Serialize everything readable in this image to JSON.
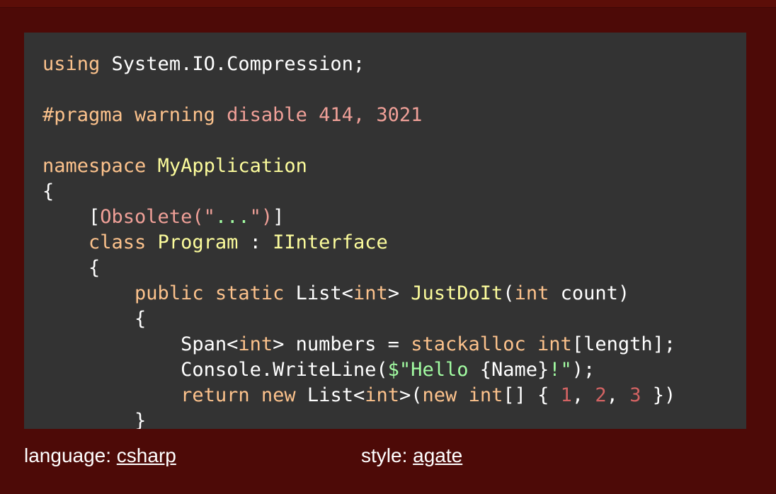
{
  "colors": {
    "background": "#4d0a07",
    "code_background": "#333333",
    "keyword": "#fcc28c",
    "title": "#fcfc9c",
    "meta": "#f0a098",
    "string": "#a2fca2",
    "number": "#d36363",
    "plain": "#ffffff"
  },
  "code_lines": [
    [
      [
        "k",
        "using"
      ],
      [
        "p",
        " System.IO.Compression;"
      ]
    ],
    [],
    [
      [
        "k",
        "#pragma warning"
      ],
      [
        "m",
        " disable 414, 3021"
      ]
    ],
    [],
    [
      [
        "k",
        "namespace"
      ],
      [
        "p",
        " "
      ],
      [
        "t",
        "MyApplication"
      ]
    ],
    [
      [
        "p",
        "{"
      ]
    ],
    [
      [
        "p",
        "    ["
      ],
      [
        "m",
        "Obsolete(\""
      ],
      [
        "s",
        "..."
      ],
      [
        "m",
        "\")"
      ],
      [
        "p",
        "]"
      ]
    ],
    [
      [
        "p",
        "    "
      ],
      [
        "k",
        "class"
      ],
      [
        "p",
        " "
      ],
      [
        "t",
        "Program"
      ],
      [
        "p",
        " : "
      ],
      [
        "t",
        "IInterface"
      ]
    ],
    [
      [
        "p",
        "    {"
      ]
    ],
    [
      [
        "p",
        "        "
      ],
      [
        "k",
        "public"
      ],
      [
        "p",
        " "
      ],
      [
        "k",
        "static"
      ],
      [
        "p",
        " List<"
      ],
      [
        "k",
        "int"
      ],
      [
        "p",
        "> "
      ],
      [
        "t",
        "JustDoIt"
      ],
      [
        "p",
        "("
      ],
      [
        "k",
        "int"
      ],
      [
        "p",
        " count)"
      ]
    ],
    [
      [
        "p",
        "        {"
      ]
    ],
    [
      [
        "p",
        "            Span<"
      ],
      [
        "k",
        "int"
      ],
      [
        "p",
        "> numbers = "
      ],
      [
        "k",
        "stackalloc"
      ],
      [
        "p",
        " "
      ],
      [
        "k",
        "int"
      ],
      [
        "p",
        "[length];"
      ]
    ],
    [
      [
        "p",
        "            Console.WriteLine("
      ],
      [
        "s",
        "$\"Hello "
      ],
      [
        "p",
        "{Name}"
      ],
      [
        "s",
        "!\""
      ],
      [
        "p",
        ");"
      ]
    ],
    [
      [
        "p",
        "            "
      ],
      [
        "k",
        "return"
      ],
      [
        "p",
        " "
      ],
      [
        "k",
        "new"
      ],
      [
        "p",
        " List<"
      ],
      [
        "k",
        "int"
      ],
      [
        "p",
        ">("
      ],
      [
        "k",
        "new"
      ],
      [
        "p",
        " "
      ],
      [
        "k",
        "int"
      ],
      [
        "p",
        "[] { "
      ],
      [
        "n",
        "1"
      ],
      [
        "p",
        ", "
      ],
      [
        "n",
        "2"
      ],
      [
        "p",
        ", "
      ],
      [
        "n",
        "3"
      ],
      [
        "p",
        " })"
      ]
    ],
    [
      [
        "p",
        "        }"
      ]
    ]
  ],
  "footer": {
    "language_label": "language: ",
    "language_value": "csharp",
    "style_label": "style: ",
    "style_value": "agate"
  }
}
